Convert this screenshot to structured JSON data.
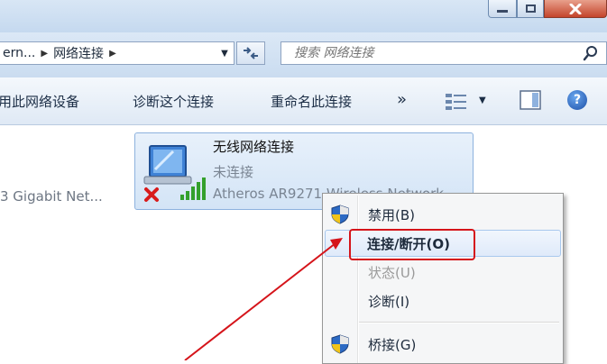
{
  "window": {
    "controls": {
      "minimize": "minimize",
      "maximize": "maximize",
      "close": "close"
    }
  },
  "address": {
    "segments": [
      "ern...",
      "网络连接"
    ]
  },
  "search": {
    "placeholder": "搜索 网络连接"
  },
  "toolbar": {
    "disable_device": "用此网络设备",
    "diagnose": "诊断这个连接",
    "rename": "重命名此连接",
    "more": "»"
  },
  "content": {
    "left_item_label": "3 Gigabit Net...",
    "wifi": {
      "name": "无线网络连接",
      "status": "未连接",
      "adapter": "Atheros AR9271 Wireless Network"
    }
  },
  "context_menu": {
    "items": [
      {
        "label": "禁用(B)",
        "icon": "shield-icon",
        "disabled": false
      },
      {
        "label": "连接/断开(O)",
        "icon": "",
        "disabled": false,
        "highlighted": true
      },
      {
        "label": "状态(U)",
        "icon": "",
        "disabled": true
      },
      {
        "label": "诊断(I)",
        "icon": "",
        "disabled": false
      },
      {
        "label": "桥接(G)",
        "icon": "shield-icon",
        "disabled": false
      }
    ]
  },
  "colors": {
    "annotation_red": "#d5141a",
    "menu_highlight": "#dfeafa",
    "selected_tile": "#d3e4f6"
  }
}
